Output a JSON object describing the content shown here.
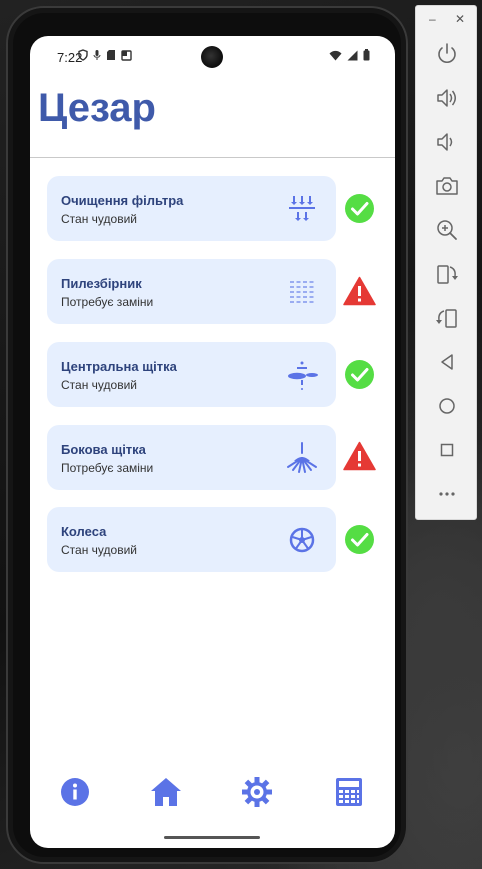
{
  "status_bar": {
    "time": "7:22"
  },
  "app": {
    "title": "Цезар"
  },
  "cards": [
    {
      "title": "Очищення фільтра",
      "status": "Стан чудовий",
      "icon": "filter-cleaning-icon",
      "ok": true
    },
    {
      "title": "Пилезбірник",
      "status": "Потребує заміни",
      "icon": "dustbin-icon",
      "ok": false
    },
    {
      "title": "Центральна щітка",
      "status": "Стан чудовий",
      "icon": "main-brush-icon",
      "ok": true
    },
    {
      "title": "Бокова щітка",
      "status": "Потребує заміни",
      "icon": "side-brush-icon",
      "ok": false
    },
    {
      "title": "Колеса",
      "status": "Стан чудовий",
      "icon": "wheel-icon",
      "ok": true
    }
  ],
  "bottom_nav": [
    {
      "icon": "info-icon"
    },
    {
      "icon": "home-icon"
    },
    {
      "icon": "settings-gear-icon"
    },
    {
      "icon": "calculator-icon"
    }
  ],
  "emulator_toolbar": {
    "window_minimize": "–",
    "window_close": "✕",
    "buttons": [
      "power-icon",
      "volume-up-icon",
      "volume-down-icon",
      "camera-icon",
      "zoom-icon",
      "rotate-left-icon",
      "rotate-right-icon",
      "back-icon",
      "home-circle-icon",
      "overview-icon",
      "more-icon"
    ]
  },
  "colors": {
    "accent": "#3f5aaa",
    "card_bg": "#e6effe",
    "icon_blue": "#5b73e6",
    "ok_green": "#55dd44",
    "warn_red": "#e53935"
  }
}
